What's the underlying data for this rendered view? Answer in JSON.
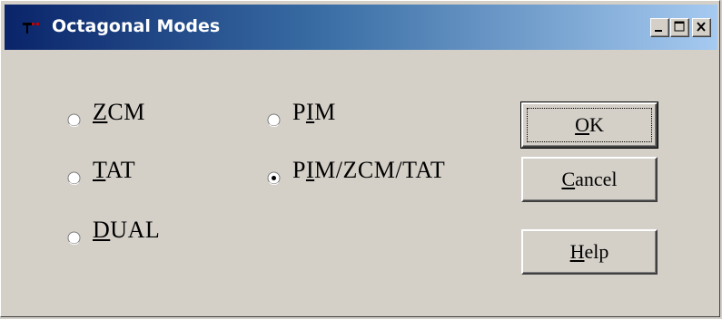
{
  "window": {
    "title": "Octagonal Modes",
    "controls": {
      "minimize": "minimize-icon",
      "maximize": "maximize-icon",
      "close": "close-icon"
    }
  },
  "modes": [
    {
      "label": "ZCM",
      "mnemonic_index": 0,
      "selected": false
    },
    {
      "label": "TAT",
      "mnemonic_index": 0,
      "selected": false
    },
    {
      "label": "DUAL",
      "mnemonic_index": 0,
      "selected": false
    },
    {
      "label": "PIM",
      "mnemonic_index": 1,
      "selected": false
    },
    {
      "label": "PIM/ZCM/TAT",
      "mnemonic_index": 1,
      "selected": true
    }
  ],
  "buttons": {
    "ok": {
      "label": "OK",
      "mnemonic_index": 0
    },
    "cancel": {
      "label": "Cancel",
      "mnemonic_index": 0
    },
    "help": {
      "label": "Help",
      "mnemonic_index": 0
    }
  },
  "colors": {
    "title_start": "#0a246a",
    "title_end": "#a6caf0",
    "face": "#d4d0c8"
  }
}
